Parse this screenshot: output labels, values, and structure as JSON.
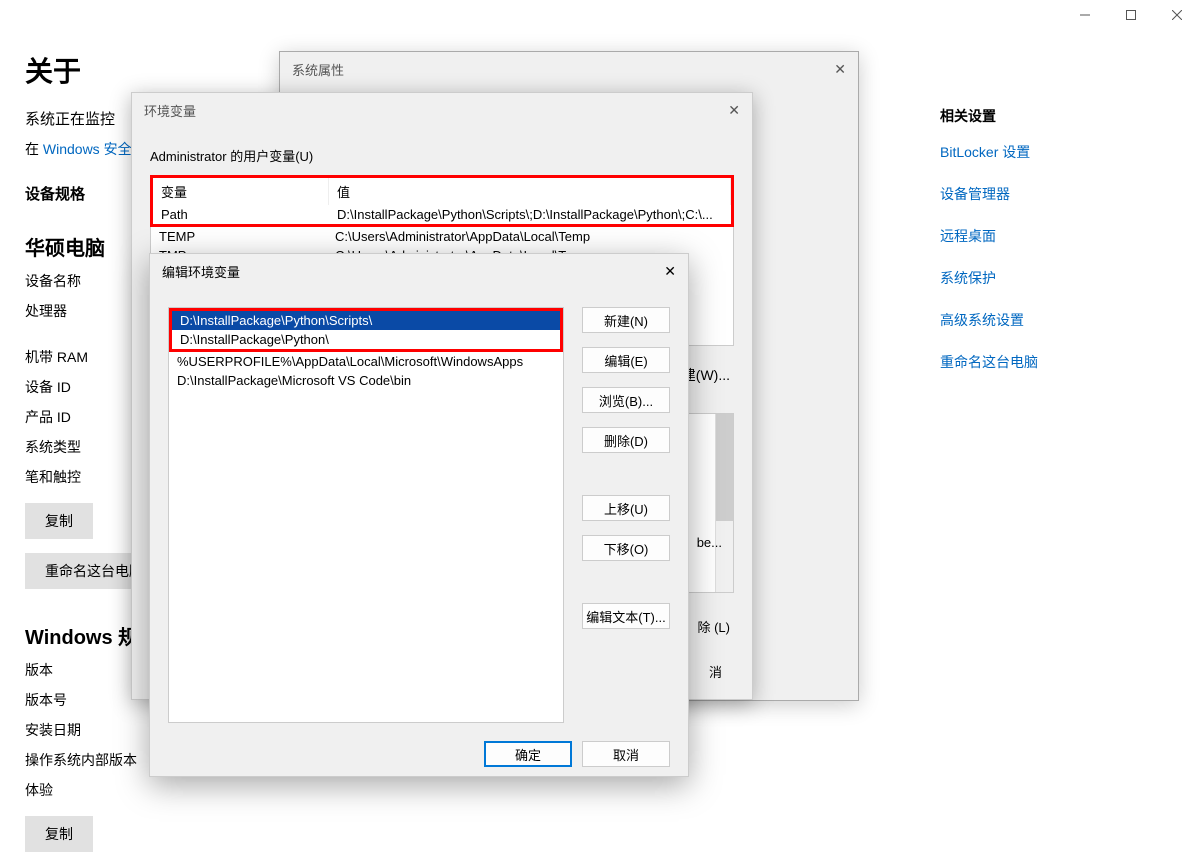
{
  "settings": {
    "title": "关于",
    "monitoring": "系统正在监控",
    "security_link_pre": "在 ",
    "security_link": "Windows 安全",
    "spec_heading": "设备规格",
    "brand": "华硕电脑",
    "labels": {
      "device_name": "设备名称",
      "processor": "处理器",
      "ram": "机带 RAM",
      "device_id": "设备 ID",
      "product_id": "产品 ID",
      "system_type": "系统类型",
      "pen_touch": "笔和触控"
    },
    "copy_btn": "复制",
    "rename_btn": "重命名这台电脑",
    "win_spec_heading": "Windows 规",
    "win_labels": {
      "edition": "版本",
      "version": "版本号",
      "install_date": "安装日期",
      "os_build": "操作系统内部版本",
      "experience": "体验"
    }
  },
  "right": {
    "heading": "相关设置",
    "links": [
      "BitLocker 设置",
      "设备管理器",
      "远程桌面",
      "系统保护",
      "高级系统设置",
      "重命名这台电脑"
    ]
  },
  "sysprop": {
    "title": "系统属性"
  },
  "env": {
    "title": "环境变量",
    "user_label": "Administrator 的用户变量(U)",
    "cols": {
      "name": "变量",
      "value": "值"
    },
    "user_vars": [
      {
        "name": "Path",
        "value": "D:\\InstallPackage\\Python\\Scripts\\;D:\\InstallPackage\\Python\\;C:\\..."
      },
      {
        "name": "TEMP",
        "value": "C:\\Users\\Administrator\\AppData\\Local\\Temp"
      },
      {
        "name": "TMP",
        "value": "C:\\Users\\Administrator\\AppData\\Local\\Temp"
      }
    ],
    "new_btn_partial": "建(W)...",
    "delete_btn_partial": "除 (L)",
    "cancel_partial": "消",
    "be_partial": "be..."
  },
  "edit": {
    "title": "编辑环境变量",
    "entries": [
      "D:\\InstallPackage\\Python\\Scripts\\",
      "D:\\InstallPackage\\Python\\",
      "%USERPROFILE%\\AppData\\Local\\Microsoft\\WindowsApps",
      "D:\\InstallPackage\\Microsoft VS Code\\bin"
    ],
    "buttons": {
      "new": "新建(N)",
      "edit": "编辑(E)",
      "browse": "浏览(B)...",
      "delete": "删除(D)",
      "up": "上移(U)",
      "down": "下移(O)",
      "edit_text": "编辑文本(T)...",
      "ok": "确定",
      "cancel": "取消"
    }
  }
}
